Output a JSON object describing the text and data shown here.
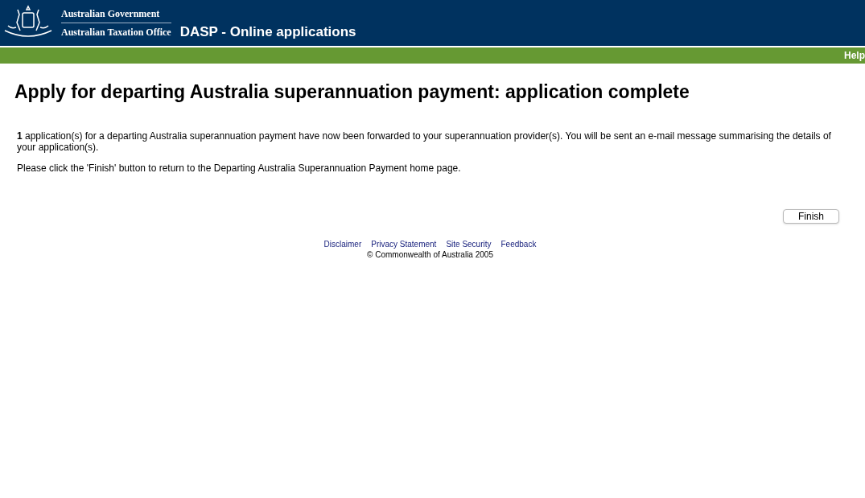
{
  "header": {
    "agency_line_1": "Australian Government",
    "agency_line_2": "Australian Taxation Office",
    "app_title": "DASP - Online applications"
  },
  "nav": {
    "help_link": "Help"
  },
  "page_title": "Apply for departing Australia superannuation payment: application complete",
  "paragraphs": [
    "**1** application(s) for a departing Australia superannuation payment have now been forwarded to your superannuation provider(s). You will be sent an e-mail message summarising the details of your application(s).",
    "Please click the 'Finish' button to return to the Departing Australia Superannuation Payment home page."
  ],
  "finish_button": "Finish",
  "footer": {
    "links": [
      "Disclaimer",
      "Privacy Statement",
      "Site Security",
      "Feedback"
    ],
    "copyright": "© Commonwealth of Australia 2005"
  }
}
